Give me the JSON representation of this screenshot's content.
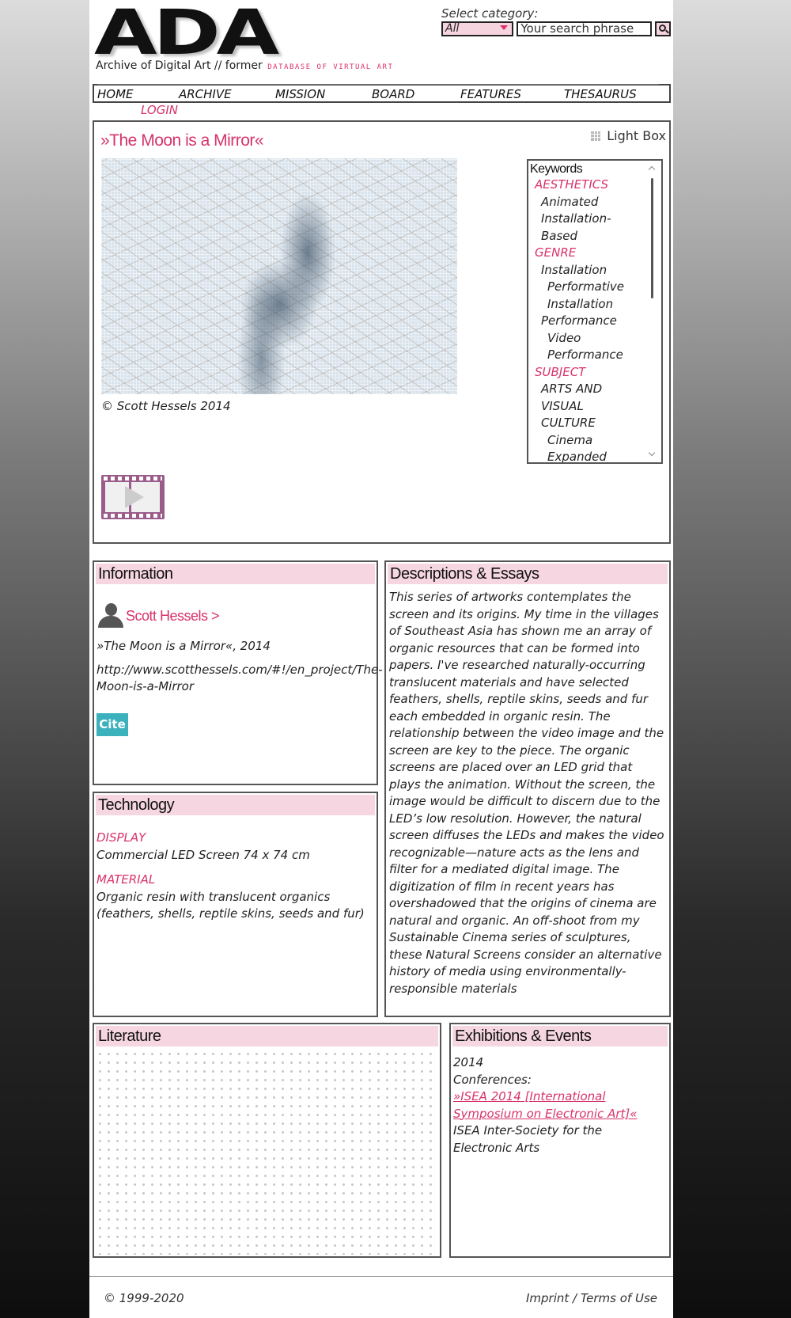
{
  "header": {
    "logo": "ADA",
    "tagline": "Archive of Digital Art // former",
    "tagline_db": "database of virtual art",
    "search": {
      "label": "Select category:",
      "category_value": "All",
      "placeholder": "Your search phrase"
    }
  },
  "nav": {
    "items": [
      {
        "label": "HOME"
      },
      {
        "label": "ARCHIVE"
      },
      {
        "label": "MISSION"
      },
      {
        "label": "BOARD"
      },
      {
        "label": "FEATURES"
      },
      {
        "label": "THESAURUS"
      }
    ],
    "login": "LOGIN"
  },
  "artwork": {
    "title": "»The Moon is a Mirror«",
    "lightbox_label": "Light Box",
    "copyright": "© Scott Hessels 2014",
    "keywords_title": "Keywords",
    "keywords": [
      {
        "text": "AESTHETICS",
        "level": "cat"
      },
      {
        "text": "Animated",
        "level": "l1"
      },
      {
        "text": "Installation-",
        "level": "l1"
      },
      {
        "text": "Based",
        "level": "l1"
      },
      {
        "text": "GENRE",
        "level": "cat"
      },
      {
        "text": "Installation",
        "level": "l1"
      },
      {
        "text": "Performative",
        "level": "l2"
      },
      {
        "text": "Installation",
        "level": "l2"
      },
      {
        "text": "Performance",
        "level": "l1"
      },
      {
        "text": "Video",
        "level": "l2"
      },
      {
        "text": "Performance",
        "level": "l2"
      },
      {
        "text": "SUBJECT",
        "level": "cat"
      },
      {
        "text": "ARTS AND",
        "level": "l1"
      },
      {
        "text": "VISUAL",
        "level": "l1"
      },
      {
        "text": "CULTURE",
        "level": "l1"
      },
      {
        "text": "Cinema",
        "level": "l2"
      },
      {
        "text": "Expanded",
        "level": "l2"
      }
    ]
  },
  "information": {
    "heading": "Information",
    "artist": "Scott Hessels >",
    "work_line": "»The Moon is a Mirror«, 2014",
    "url": "http://www.scotthessels.com/#!/en_project/The-Moon-is-a-Mirror",
    "cite_label": "Cite"
  },
  "descriptions": {
    "heading": "Descriptions & Essays",
    "text": "This series of artworks contemplates the screen and its origins. My time in the villages of Southeast Asia has shown me an array of organic resources that can be formed into papers. I've researched naturally-occurring translucent materials and have selected feathers, shells, reptile skins, seeds and fur each embedded in organic resin. The relationship between the video image and the screen are key to the piece. The organic screens are placed over an LED grid that plays the animation. Without the screen, the image would be difficult to discern due to the LED’s low resolution. However, the natural screen diffuses the LEDs and makes the video recognizable—nature acts as the lens and filter for a mediated digital image. The digitization of film in recent years has overshadowed that the origins of cinema are natural and organic. An off-shoot from my Sustainable Cinema series of sculptures, these Natural Screens consider an alternative history of media using environmentally-responsible materials"
  },
  "technology": {
    "heading": "Technology",
    "display_label": "DISPLAY",
    "display_value": "Commercial LED Screen 74 x 74 cm",
    "material_label": "MATERIAL",
    "material_value": "Organic resin with translucent organics (feathers, shells, reptile skins, seeds and fur)"
  },
  "literature": {
    "heading": "Literature"
  },
  "exhibitions": {
    "heading": "Exhibitions & Events",
    "year": "2014",
    "type": "Conferences:",
    "event_link": "»ISEA 2014 [International Symposium on Electronic Art]«",
    "organizer": "ISEA Inter-Society for the Electronic Arts"
  },
  "footer": {
    "copyright": "© 1999-2020",
    "links": "Imprint / Terms of Use"
  },
  "colors": {
    "accent": "#d8336a",
    "header_band": "#f5d6e1",
    "cite_button": "#3ab1bd"
  }
}
